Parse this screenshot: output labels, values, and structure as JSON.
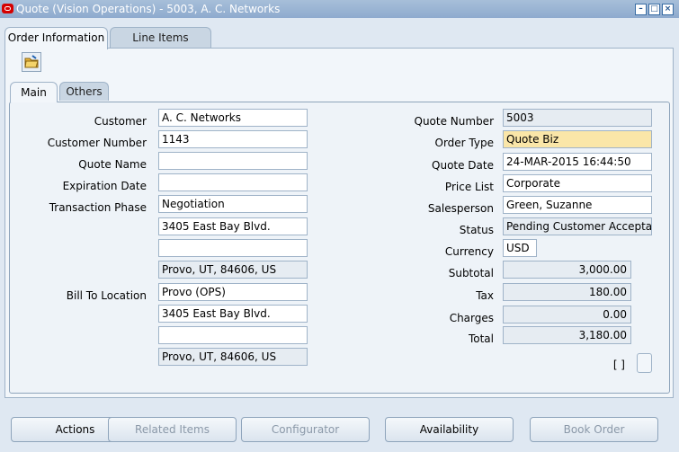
{
  "window": {
    "title": "Quote (Vision Operations) - 5003, A. C. Networks",
    "controls": [
      "–",
      "□",
      "×"
    ]
  },
  "tabs": {
    "order_information": "Order Information",
    "line_items": "Line Items"
  },
  "subtabs": {
    "main": "Main",
    "others": "Others"
  },
  "labels": {
    "customer": "Customer",
    "customer_number": "Customer Number",
    "quote_name": "Quote Name",
    "expiration_date": "Expiration Date",
    "transaction_phase": "Transaction Phase",
    "bill_to_location": "Bill To Location",
    "quote_number": "Quote Number",
    "order_type": "Order Type",
    "quote_date": "Quote Date",
    "price_list": "Price List",
    "salesperson": "Salesperson",
    "status": "Status",
    "currency": "Currency",
    "subtotal": "Subtotal",
    "tax": "Tax",
    "charges": "Charges",
    "total": "Total"
  },
  "values": {
    "customer": "A. C. Networks",
    "customer_number": "1143",
    "quote_name": "",
    "expiration_date": "",
    "transaction_phase": "Negotiation",
    "ship_addr1": "3405 East Bay Blvd.",
    "ship_addr2": "",
    "ship_city": "Provo, UT, 84606, US",
    "bill_to_location": "Provo (OPS)",
    "bill_addr1": "3405 East Bay Blvd.",
    "bill_addr2": "",
    "bill_city": "Provo, UT, 84606, US",
    "quote_number": "5003",
    "order_type": "Quote Biz",
    "quote_date": "24-MAR-2015 16:44:50",
    "price_list": "Corporate",
    "salesperson": "Green, Suzanne",
    "status": "Pending Customer Acceptar",
    "currency": "USD",
    "subtotal": "3,000.00",
    "tax": "180.00",
    "charges": "0.00",
    "total": "3,180.00"
  },
  "flex_indicator": "[ ]",
  "buttons": {
    "actions": "Actions",
    "related_items": "Related Items",
    "configurator": "Configurator",
    "availability": "Availability",
    "book_order": "Book Order"
  }
}
